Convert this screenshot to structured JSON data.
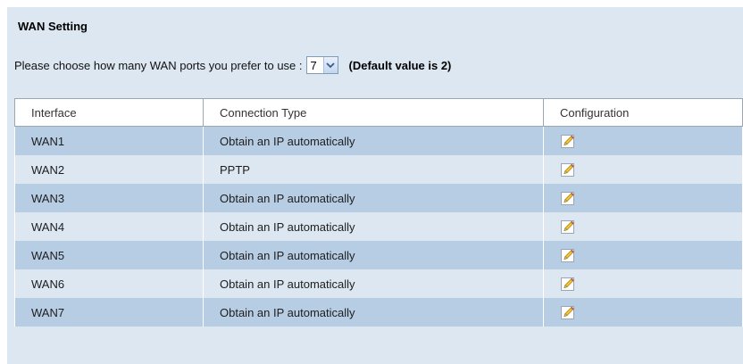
{
  "section": {
    "title": "WAN Setting"
  },
  "port_choice": {
    "prompt": "Please choose how many WAN ports you prefer to use :",
    "selected": "7",
    "default_note": "(Default value is 2)"
  },
  "table": {
    "headers": {
      "interface": "Interface",
      "connection_type": "Connection Type",
      "configuration": "Configuration"
    },
    "rows": [
      {
        "interface": "WAN1",
        "connection_type": "Obtain an IP automatically"
      },
      {
        "interface": "WAN2",
        "connection_type": "PPTP"
      },
      {
        "interface": "WAN3",
        "connection_type": "Obtain an IP automatically"
      },
      {
        "interface": "WAN4",
        "connection_type": "Obtain an IP automatically"
      },
      {
        "interface": "WAN5",
        "connection_type": "Obtain an IP automatically"
      },
      {
        "interface": "WAN6",
        "connection_type": "Obtain an IP automatically"
      },
      {
        "interface": "WAN7",
        "connection_type": "Obtain an IP automatically"
      }
    ]
  },
  "icons": {
    "configure": "edit-pencil-icon",
    "dropdown": "chevron-down-icon"
  },
  "colors": {
    "panel_background": "#dce7f2",
    "row_dark": "#b7cde3",
    "row_light": "#dce7f2",
    "header_background": "#ffffff"
  }
}
